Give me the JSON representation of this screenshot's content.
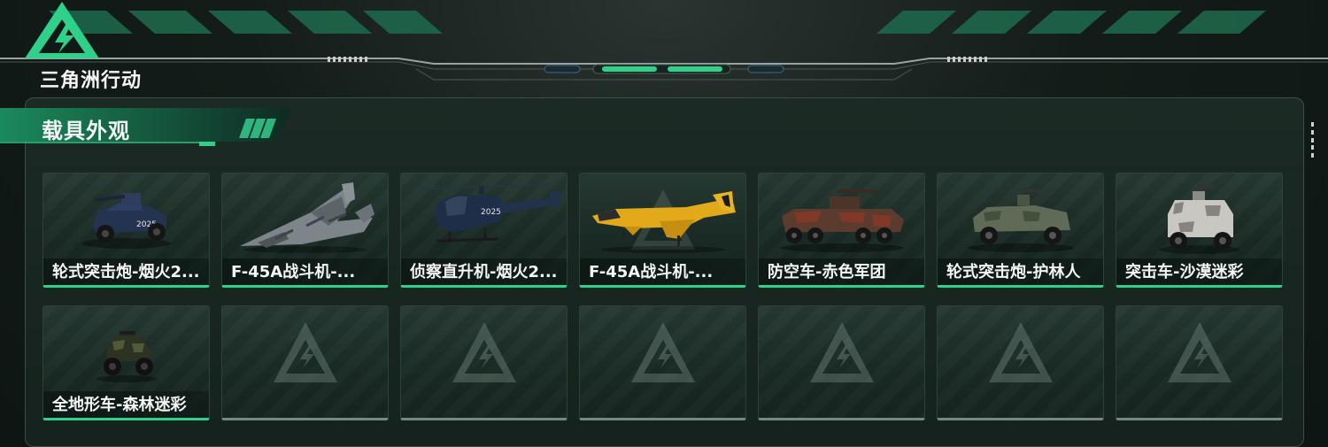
{
  "game": {
    "logo_text": "三角洲行动"
  },
  "section": {
    "title": "载具外观"
  },
  "colors": {
    "accent": "#2fd08a",
    "panel": "#1a2a24",
    "empty_bar": "#7b8581"
  },
  "vehicles": [
    {
      "label": "轮式突击炮-烟火2...",
      "art": "armored-car-blue-icon"
    },
    {
      "label": "F-45A战斗机-...",
      "art": "fighter-jet-camo-icon"
    },
    {
      "label": "侦察直升机-烟火2...",
      "art": "helicopter-blue-icon"
    },
    {
      "label": "F-45A战斗机-...",
      "art": "fighter-jet-yellow-icon"
    },
    {
      "label": "防空车-赤色军团",
      "art": "aa-vehicle-red-icon"
    },
    {
      "label": "轮式突击炮-护林人",
      "art": "armored-car-green-icon"
    },
    {
      "label": "突击车-沙漠迷彩",
      "art": "assault-vehicle-white-icon"
    },
    {
      "label": "全地形车-森林迷彩",
      "art": "atv-green-icon"
    }
  ],
  "empty_slots": 6
}
